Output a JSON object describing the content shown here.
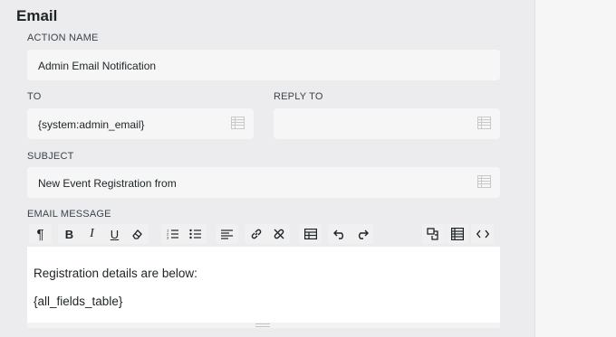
{
  "section": {
    "title": "Email"
  },
  "action_name": {
    "label": "ACTION NAME",
    "value": "Admin Email Notification"
  },
  "to": {
    "label": "TO",
    "value": "{system:admin_email}"
  },
  "reply_to": {
    "label": "REPLY TO",
    "value": ""
  },
  "subject": {
    "label": "SUBJECT",
    "value": "New Event Registration from"
  },
  "message": {
    "label": "EMAIL MESSAGE",
    "lines": [
      "Registration details are below:",
      "{all_fields_table}"
    ]
  },
  "toolbar": {
    "icons": [
      "paragraph-icon",
      "bold-icon",
      "italic-icon",
      "underline-icon",
      "clear-formatting-icon",
      "ordered-list-icon",
      "unordered-list-icon",
      "align-left-icon",
      "link-icon",
      "unlink-icon",
      "table-icon",
      "undo-icon",
      "redo-icon",
      "merge-tags-icon",
      "fields-table-icon",
      "code-view-icon"
    ],
    "bold": "B",
    "italic": "I",
    "underline": "U",
    "paragraph": "¶"
  }
}
